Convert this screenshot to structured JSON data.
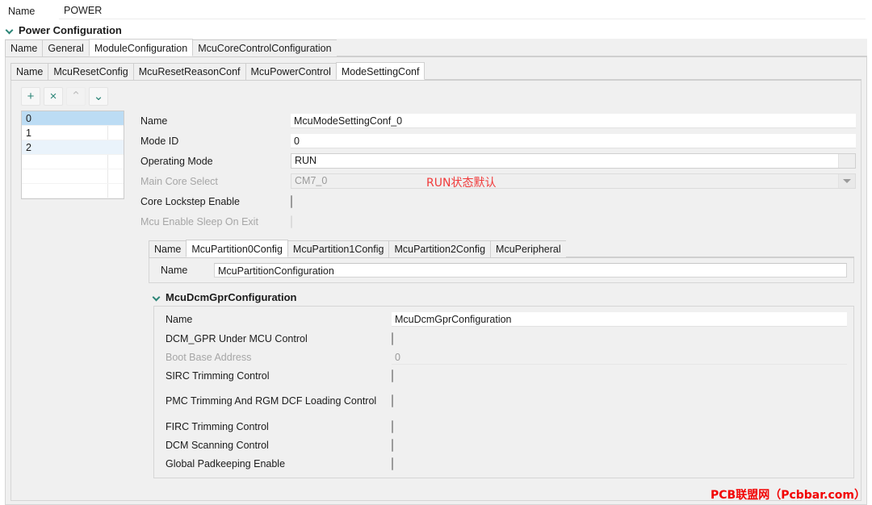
{
  "top": {
    "name_label": "Name",
    "name_value": "POWER"
  },
  "section": {
    "title": "Power Configuration",
    "chevron_icon": "chevron-down-icon"
  },
  "outer_tabs": [
    {
      "label": "Name",
      "active": false
    },
    {
      "label": "General",
      "active": false
    },
    {
      "label": "ModuleConfiguration",
      "active": true
    },
    {
      "label": "McuCoreControlConfiguration",
      "active": false
    }
  ],
  "inner_tabs": [
    {
      "label": "Name",
      "active": false
    },
    {
      "label": "McuResetConfig",
      "active": false
    },
    {
      "label": "McuResetReasonConf",
      "active": false
    },
    {
      "label": "McuPowerControl",
      "active": false
    },
    {
      "label": "ModeSettingConf",
      "active": true
    }
  ],
  "toolbar": {
    "add_label": "+",
    "remove_label": "×",
    "up_label": "⌃",
    "down_label": "⌄",
    "add_icon": "plus-icon",
    "remove_icon": "close-icon",
    "up_icon": "chevron-up-icon",
    "down_icon": "chevron-down-icon"
  },
  "list": {
    "items": [
      {
        "label": "0"
      },
      {
        "label": "1"
      },
      {
        "label": "2"
      }
    ]
  },
  "mode_form": {
    "name_label": "Name",
    "name_value": "McuModeSettingConf_0",
    "mode_id_label": "Mode ID",
    "mode_id_value": "0",
    "operating_mode_label": "Operating Mode",
    "operating_mode_value": "RUN",
    "main_core_label": "Main Core Select",
    "main_core_value": "CM7_0",
    "core_lockstep_label": "Core Lockstep Enable",
    "sleep_on_exit_label": "Mcu Enable Sleep On Exit"
  },
  "partition_tabs": [
    {
      "label": "Name",
      "active": false
    },
    {
      "label": "McuPartition0Config",
      "active": true
    },
    {
      "label": "McuPartition1Config",
      "active": false
    },
    {
      "label": "McuPartition2Config",
      "active": false
    },
    {
      "label": "McuPeripheral",
      "active": false
    }
  ],
  "partition_form": {
    "name_label": "Name",
    "name_value": "McuPartitionConfiguration"
  },
  "dcm": {
    "title": "McuDcmGprConfiguration",
    "chevron_icon": "chevron-down-icon",
    "name_label": "Name",
    "name_value": "McuDcmGprConfiguration",
    "rows": [
      {
        "label": "DCM_GPR Under MCU Control",
        "type": "checkbox",
        "disabled": false
      },
      {
        "label": "Boot Base Address",
        "type": "text",
        "value": "0",
        "disabled": true
      },
      {
        "label": "SIRC Trimming Control",
        "type": "checkbox",
        "disabled": false
      },
      {
        "label": "PMC Trimming And RGM DCF Loading Control",
        "type": "checkbox",
        "disabled": false
      },
      {
        "label": "FIRC Trimming Control",
        "type": "checkbox",
        "disabled": false
      },
      {
        "label": "DCM Scanning Control",
        "type": "checkbox",
        "disabled": false
      },
      {
        "label": "Global Padkeeping Enable",
        "type": "checkbox",
        "disabled": false
      }
    ]
  },
  "annotations": {
    "run_note": "RUN状态默认",
    "watermark": "PCB联盟网（Pcbbar.com）"
  },
  "colors": {
    "accent": "#2c8577",
    "annotation": "#f03a3a",
    "watermark": "#f20000",
    "selection": "#bcdcf4"
  }
}
